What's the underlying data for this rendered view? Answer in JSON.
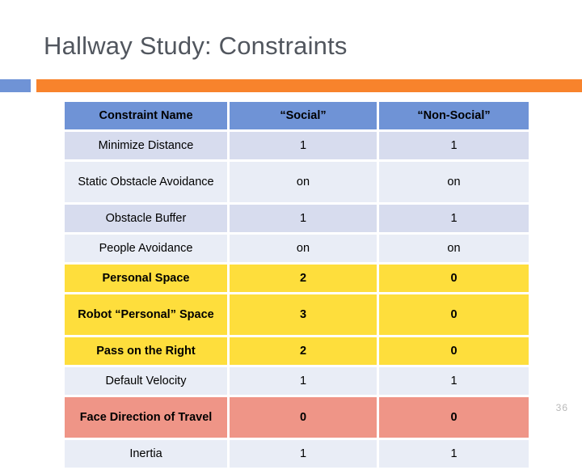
{
  "slide": {
    "title": "Hallway Study: Constraints",
    "page_number": "36",
    "accent_blue": "#6f93d6",
    "accent_orange": "#f8832c",
    "title_color": "#51565e"
  },
  "table": {
    "headers": [
      "Constraint Name",
      "“Social”",
      "“Non-Social”"
    ],
    "row_colors": {
      "band_a": "#e9edf6",
      "band_b": "#d7dcee",
      "yellow": "#fede3c",
      "salmon": "#ef9587"
    },
    "rows": [
      {
        "name": "Minimize Distance",
        "social": "1",
        "non_social": "1",
        "style": "band-b",
        "height": "short"
      },
      {
        "name": "Static Obstacle Avoidance",
        "social": "on",
        "non_social": "on",
        "style": "band-a",
        "height": "tall"
      },
      {
        "name": "Obstacle Buffer",
        "social": "1",
        "non_social": "1",
        "style": "band-b",
        "height": "short"
      },
      {
        "name": "People Avoidance",
        "social": "on",
        "non_social": "on",
        "style": "band-a",
        "height": "short"
      },
      {
        "name": "Personal Space",
        "social": "2",
        "non_social": "0",
        "style": "band-yellow",
        "height": "short"
      },
      {
        "name": "Robot “Personal” Space",
        "social": "3",
        "non_social": "0",
        "style": "band-yellow",
        "height": "tall"
      },
      {
        "name": "Pass on the Right",
        "social": "2",
        "non_social": "0",
        "style": "band-yellow",
        "height": "short"
      },
      {
        "name": "Default Velocity",
        "social": "1",
        "non_social": "1",
        "style": "band-a",
        "height": "short"
      },
      {
        "name": "Face Direction of Travel",
        "social": "0",
        "non_social": "0",
        "style": "band-salmon",
        "height": "tall"
      },
      {
        "name": "Inertia",
        "social": "1",
        "non_social": "1",
        "style": "band-a",
        "height": "short"
      }
    ]
  }
}
